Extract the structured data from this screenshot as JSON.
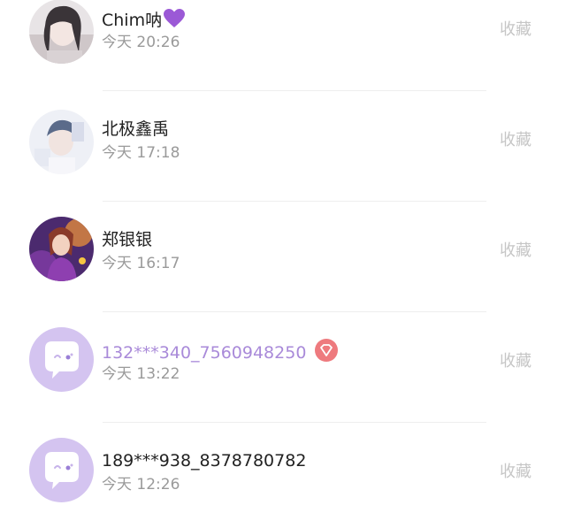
{
  "items": [
    {
      "name": "Chim呐",
      "name_emoji": "purple-heart-icon",
      "time": "今天 20:26",
      "action": "收藏",
      "avatar": "photo-girl-grey"
    },
    {
      "name": "北极鑫禹",
      "time": "今天 17:18",
      "action": "收藏",
      "avatar": "photo-boy-light"
    },
    {
      "name": "郑银银",
      "time": "今天 16:17",
      "action": "收藏",
      "avatar": "photo-anime-character"
    },
    {
      "name": "132***340_7560948250",
      "time": "今天 13:22",
      "action": "收藏",
      "avatar": "default-chat-bubble-icon",
      "name_color": "#a98ad9",
      "badge": "diamond-vip-icon"
    },
    {
      "name": "189***938_8378780782",
      "time": "今天 12:26",
      "action": "收藏",
      "avatar": "default-chat-bubble-icon"
    }
  ],
  "colors": {
    "default_avatar_bg": "#d4c4f0",
    "vip_name": "#a98ad9",
    "badge_bg": "#ee7a7e"
  }
}
